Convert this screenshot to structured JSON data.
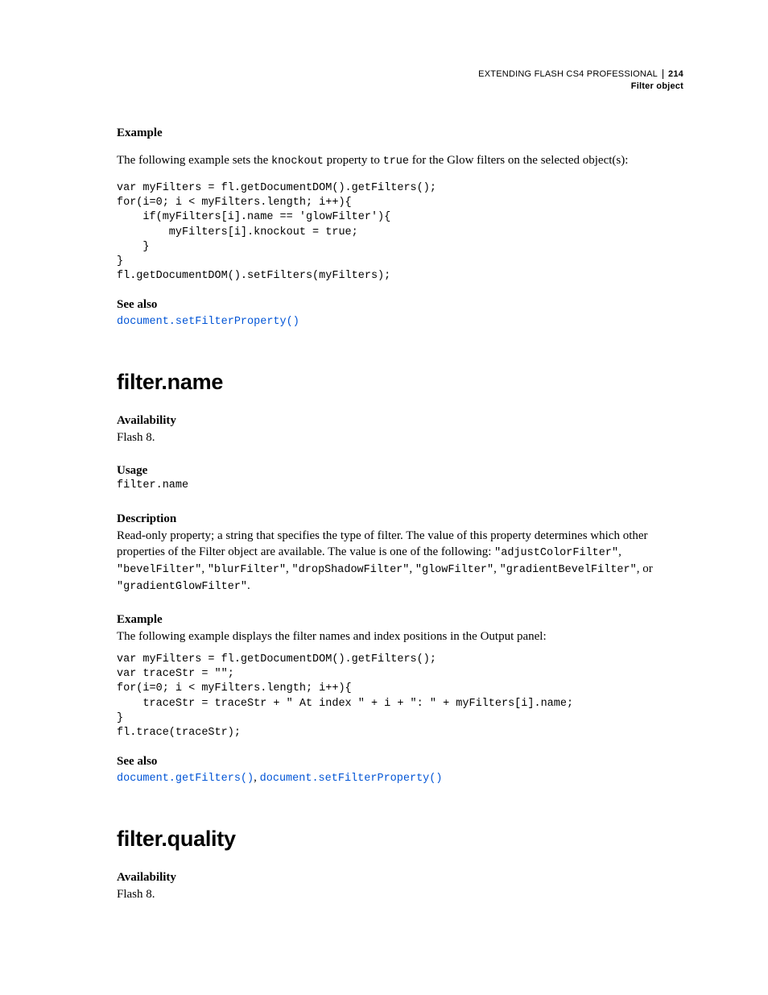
{
  "header": {
    "doc_title": "EXTENDING FLASH CS4 PROFESSIONAL",
    "page_number": "214",
    "section": "Filter object"
  },
  "sec_knockout": {
    "example_label": "Example",
    "example_intro_a": "The following example sets the ",
    "example_inline1": "knockout",
    "example_intro_b": " property to ",
    "example_inline2": "true",
    "example_intro_c": " for the Glow filters on the selected object(s):",
    "code": "var myFilters = fl.getDocumentDOM().getFilters();\nfor(i=0; i < myFilters.length; i++){\n    if(myFilters[i].name == 'glowFilter'){\n        myFilters[i].knockout = true;\n    }\n}\nfl.getDocumentDOM().setFilters(myFilters);",
    "seealso_label": "See also",
    "seealso_link": "document.setFilterProperty()"
  },
  "sec_name": {
    "title": "filter.name",
    "avail_label": "Availability",
    "avail_text": "Flash 8.",
    "usage_label": "Usage",
    "usage_code": "filter.name",
    "desc_label": "Description",
    "desc_a": "Read-only property; a string that specifies the type of filter. The value of this property determines which other properties of the Filter object are available. The value is one of the following: ",
    "c1": "\"adjustColorFilter\"",
    "s1": ", ",
    "c2": "\"bevelFilter\"",
    "s2": ", ",
    "c3": "\"blurFilter\"",
    "s3": ", ",
    "c4": "\"dropShadowFilter\"",
    "s4": ", ",
    "c5": "\"glowFilter\"",
    "s5": ", ",
    "c6": "\"gradientBevelFilter\"",
    "s6": ", or ",
    "c7": "\"gradientGlowFilter\"",
    "desc_end": ".",
    "example_label": "Example",
    "example_intro": "The following example displays the filter names and index positions in the Output panel:",
    "code": "var myFilters = fl.getDocumentDOM().getFilters();\nvar traceStr = \"\";\nfor(i=0; i < myFilters.length; i++){\n    traceStr = traceStr + \" At index \" + i + \": \" + myFilters[i].name;\n}\nfl.trace(traceStr);",
    "seealso_label": "See also",
    "seealso_link1": "document.getFilters()",
    "seealso_sep": ", ",
    "seealso_link2": "document.setFilterProperty()"
  },
  "sec_quality": {
    "title": "filter.quality",
    "avail_label": "Availability",
    "avail_text": "Flash 8."
  }
}
